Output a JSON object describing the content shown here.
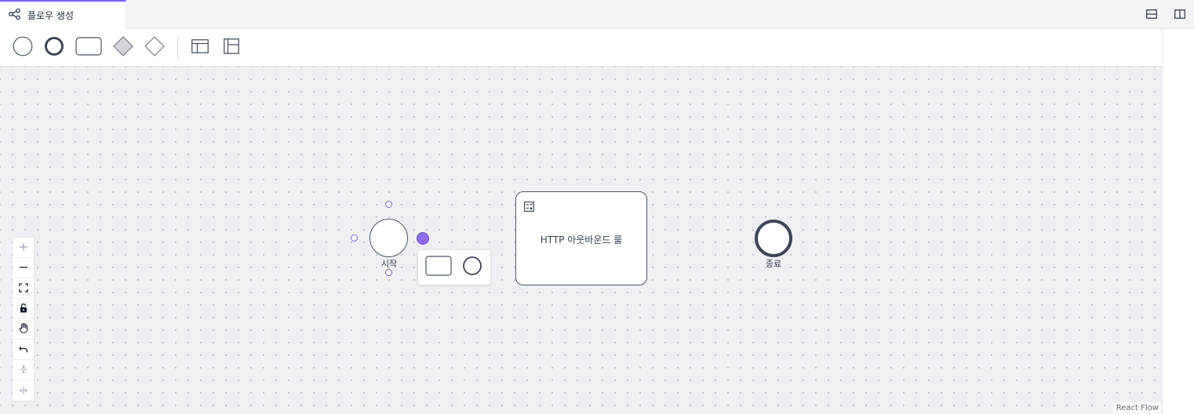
{
  "tab": {
    "title": "플로우 생성"
  },
  "icons": {
    "tab": "flow-share-icon",
    "split_horizontal": "split-horizontal-icon",
    "split_vertical": "split-vertical-icon"
  },
  "toolbar": {
    "tools": [
      "start-event",
      "end-event",
      "task",
      "gateway-filled",
      "gateway-empty",
      "table-horizontal",
      "table-vertical"
    ]
  },
  "nodes": {
    "start": {
      "label": "시작"
    },
    "task": {
      "label": "HTTP 아웃바운드 룰"
    },
    "end": {
      "label": "종료"
    }
  },
  "controls": [
    "zoom-in",
    "zoom-out",
    "fit-view",
    "lock",
    "pan",
    "undo",
    "align-vertical",
    "align-horizontal"
  ],
  "attribution": "React Flow",
  "colors": {
    "accent": "#7c5cff",
    "handle_active": "#8b6cf6",
    "canvas": "#eef0f3",
    "node_border": "#4b5563"
  }
}
